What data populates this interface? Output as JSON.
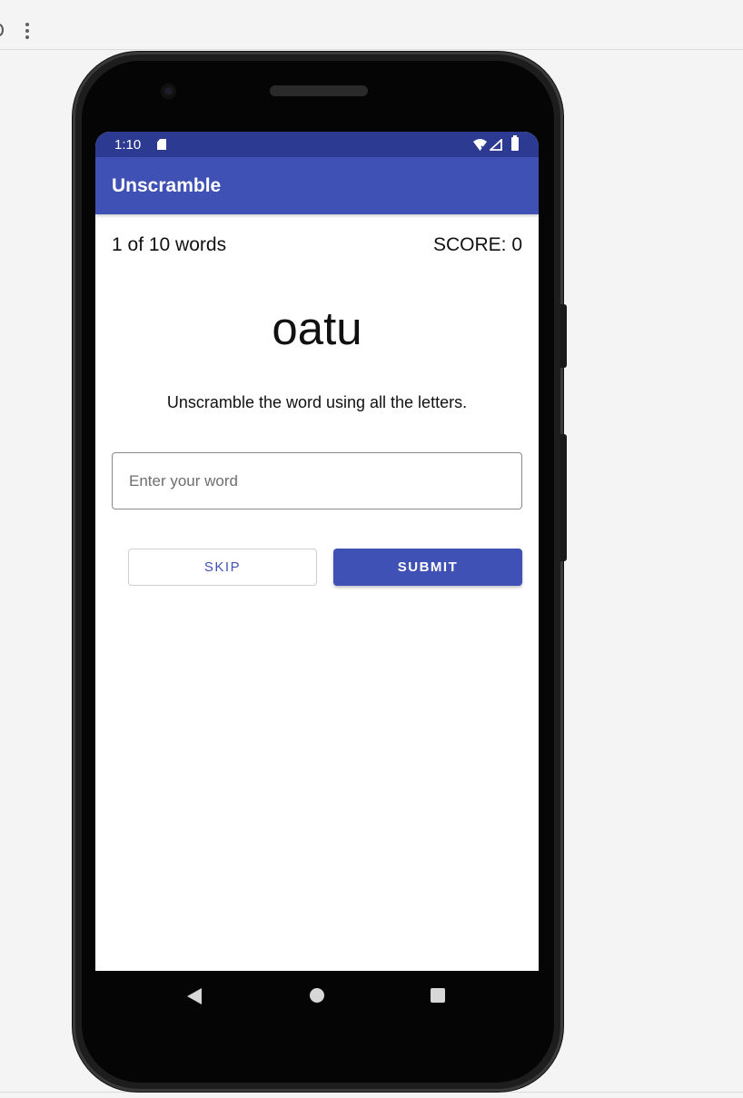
{
  "host": {
    "menu_icon": "more-vert-icon",
    "partial_icon": "refresh-icon"
  },
  "status_bar": {
    "time": "1:10",
    "icons": [
      "sd-card-icon",
      "wifi-icon",
      "signal-icon",
      "battery-icon"
    ]
  },
  "app_bar": {
    "title": "Unscramble"
  },
  "game": {
    "word_count": "1 of 10 words",
    "score": "SCORE: 0",
    "scrambled_word": "oatu",
    "instructions": "Unscramble the word using all the letters.",
    "input_placeholder": "Enter your word",
    "input_value": "",
    "skip_label": "SKIP",
    "submit_label": "SUBMIT"
  },
  "nav_bar": {
    "icons": [
      "back-icon",
      "home-icon",
      "recents-icon"
    ]
  },
  "colors": {
    "primary": "#3f51b5",
    "status_bar": "#2c3a92",
    "background": "#ffffff"
  }
}
